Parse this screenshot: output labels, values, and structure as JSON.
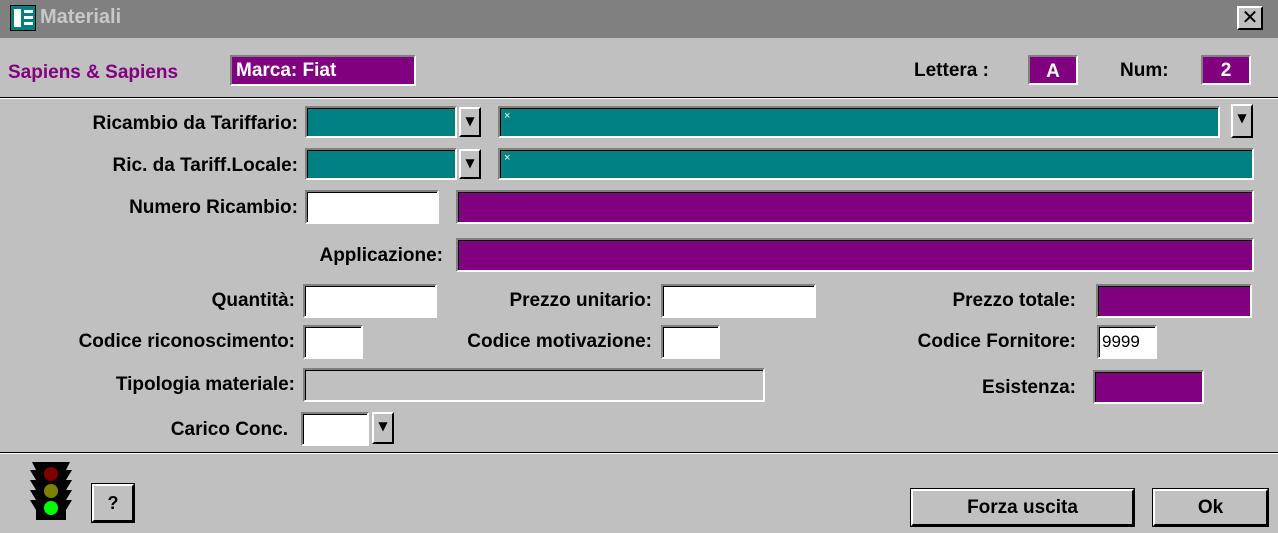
{
  "window": {
    "title": "Materiali",
    "close_glyph": "✕"
  },
  "header": {
    "company": "Sapiens & Sapiens",
    "brand": "Marca: Fiat",
    "lettera_label": "Lettera :",
    "lettera_value": "A",
    "num_label": "Num:",
    "num_value": "2"
  },
  "form": {
    "ricambio_tariffario_label": "Ricambio da Tariffario:",
    "ricambio_locale_label": "Ric. da Tariff.Locale:",
    "numero_ricambio_label": "Numero Ricambio:",
    "applicazione_label": "Applicazione:",
    "quantita_label": "Quantità:",
    "prezzo_unitario_label": "Prezzo unitario:",
    "prezzo_totale_label": "Prezzo totale:",
    "codice_riconoscimento_label": "Codice riconoscimento:",
    "codice_motivazione_label": "Codice motivazione:",
    "codice_fornitore_label": "Codice Fornitore:",
    "codice_fornitore_value": "9999",
    "tipologia_label": "Tipologia materiale:",
    "esistenza_label": "Esistenza:",
    "carico_label": "Carico Conc.",
    "small_marker": "×"
  },
  "footer": {
    "help_label": "?",
    "forza_label": "Forza uscita",
    "ok_label": "Ok"
  },
  "colors": {
    "teal": "#008080",
    "magenta": "#800080",
    "panel": "#c0c0c0"
  },
  "icons": [
    "window-app-icon",
    "close-icon",
    "dropdown-arrow-icon",
    "traffic-light-icon"
  ]
}
